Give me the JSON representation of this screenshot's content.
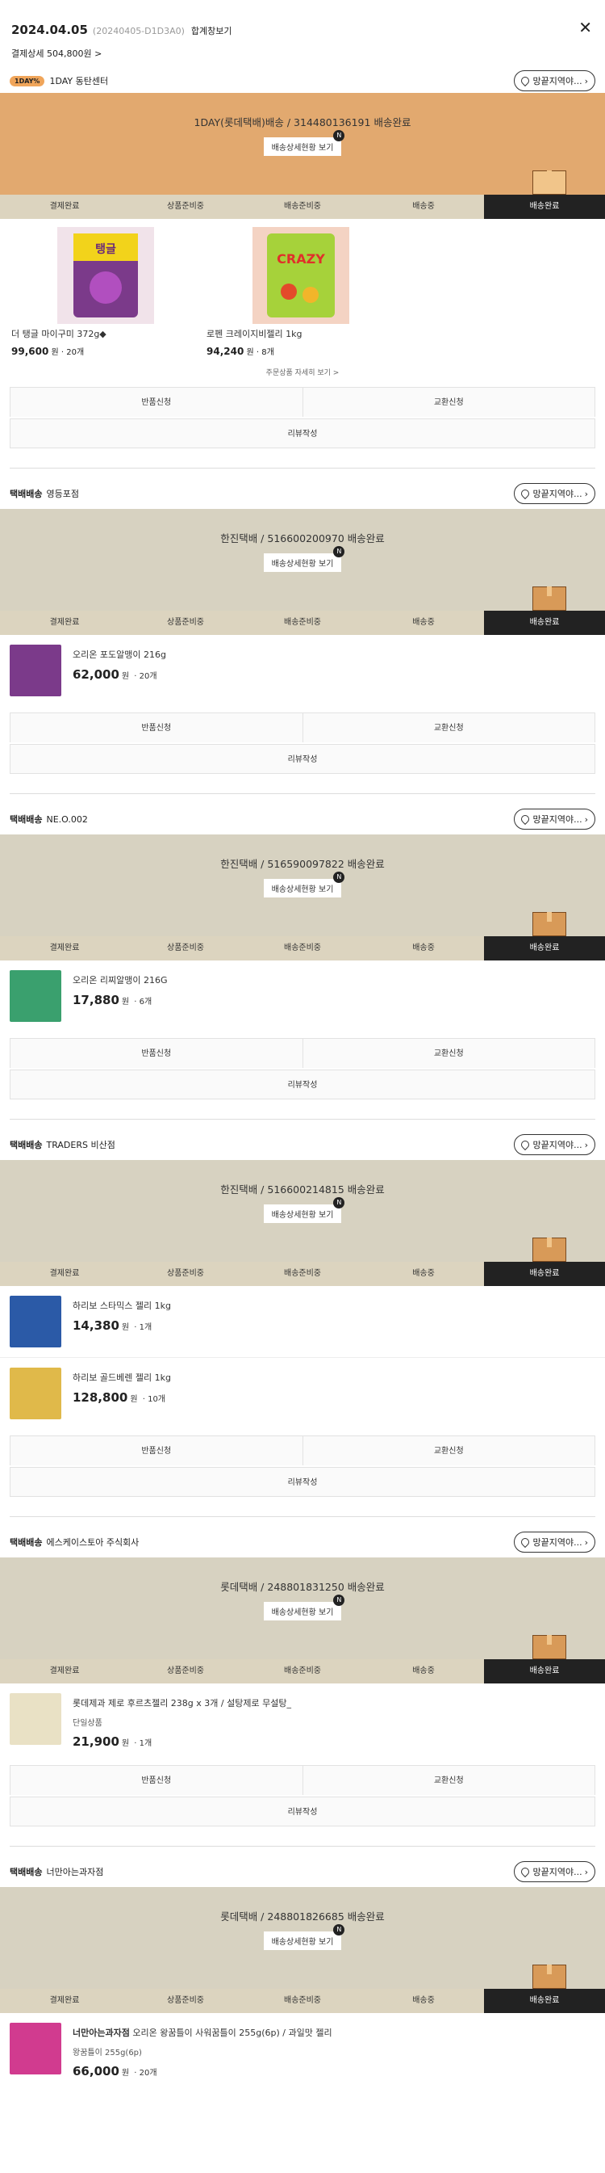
{
  "header": {
    "date": "2024.04.05",
    "order_no": "(20240405-D1D3A0)",
    "merge_link": "합계창보기",
    "close_icon": "close-icon",
    "detail": "결제상세 504,800원 >"
  },
  "shipments": [
    {
      "tag": "",
      "logo": "1DAY%",
      "seller": "1DAY 동탄센터",
      "location": "망끝지역야...",
      "carrier": "1DAY(롯데택배)배송 / 314480136191 배송완료",
      "detail_btn": "배송상세현황 보기",
      "badge": "N",
      "banner_color": "#e2a96f"
    },
    {
      "tag": "택배배송",
      "seller": "영등포점",
      "location": "망끝지역야...",
      "carrier": "한진택배 / 516600200970 배송완료",
      "detail_btn": "배송상세현황 보기",
      "badge": "N",
      "banner_color": "#d7d2c1"
    },
    {
      "tag": "택배배송",
      "seller": "NE.O.002",
      "location": "망끝지역야...",
      "carrier": "한진택배 / 516590097822 배송완료",
      "detail_btn": "배송상세현황 보기",
      "badge": "N",
      "banner_color": "#d7d2c1"
    },
    {
      "tag": "택배배송",
      "seller": "TRADERS 비산점",
      "location": "망끝지역야...",
      "carrier": "한진택배 / 516600214815 배송완료",
      "detail_btn": "배송상세현황 보기",
      "badge": "N",
      "banner_color": "#d7d2c1"
    },
    {
      "tag": "택배배송",
      "seller": "에스케이스토아 주식회사",
      "location": "망끝지역야...",
      "carrier": "롯데택배 / 248801831250 배송완료",
      "detail_btn": "배송상세현황 보기",
      "badge": "N",
      "banner_color": "#d7d2c1"
    },
    {
      "tag": "택배배송",
      "seller": "너만아는과자점",
      "location": "망끝지역야...",
      "carrier": "롯데택배 / 248801826685 배송완료",
      "detail_btn": "배송상세현황 보기",
      "badge": "N",
      "banner_color": "#d7d2c1"
    }
  ],
  "steps": [
    "결제완료",
    "상품준비중",
    "배송준비중",
    "배송중",
    "배송완료"
  ],
  "gallery": [
    {
      "name": "더 탱글 마이구미 372g◆",
      "price": "99,600",
      "unit": "원",
      "qty": "20개"
    },
    {
      "name": "로펜 크레이지비젤리 1kg",
      "price": "94,240",
      "unit": "원",
      "qty": "8개"
    }
  ],
  "gallery_more": "주문상품 자세히 보기 >",
  "products": [
    {
      "name": "오리온 포도알맹이 216g",
      "price": "62,000",
      "unit": "원",
      "qty": "20개"
    },
    {
      "name": "오리온 리찌알맹이 216G",
      "price": "17,880",
      "unit": "원",
      "qty": "6개"
    },
    {
      "name": "하리보 스타믹스 젤리 1kg",
      "price": "14,380",
      "unit": "원",
      "qty": "1개"
    },
    {
      "name": "하리보 골드베렌 젤리 1kg",
      "price": "128,800",
      "unit": "원",
      "qty": "10개"
    },
    {
      "name": "롯데제과 제로 후르츠젤리 238g x 3개 / 설탕제로 무설탕_",
      "option": "단일상품",
      "price": "21,900",
      "unit": "원",
      "qty": "1개"
    },
    {
      "name": "오리온 왕꿈틀이 사워꿈틀이 255g(6p) / 과일맛 젤리",
      "seller_bold": "너만아는과자점",
      "option": "왕꿈틀이 255g(6p)",
      "price": "66,000",
      "unit": "원",
      "qty": "20개"
    }
  ],
  "buttons": {
    "return": "반품신청",
    "exchange": "교환신청",
    "review": "리뷰작성"
  },
  "colors": {
    "accent_bar": "#222222",
    "step_bar": "#dcd4bf",
    "orange_banner": "#e2a96f",
    "gray_banner": "#d7d2c1"
  }
}
